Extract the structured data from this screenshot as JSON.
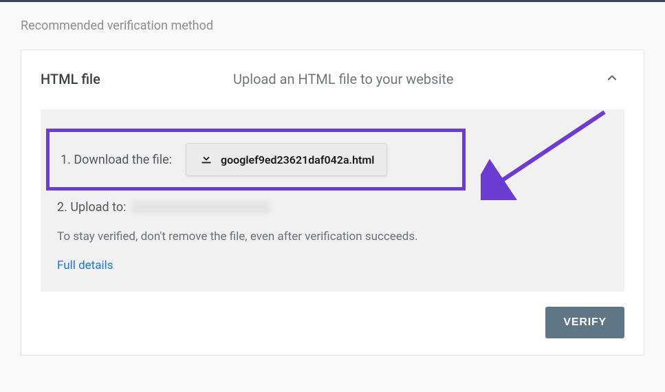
{
  "section_label": "Recommended verification method",
  "card": {
    "title": "HTML file",
    "subtitle": "Upload an HTML file to your website"
  },
  "steps": {
    "download_label": "1. Download the file:",
    "download_filename": "googlef9ed23621daf042a.html",
    "upload_label": "2. Upload to:"
  },
  "hint": "To stay verified, don't remove the file, even after verification succeeds.",
  "full_details": "Full details",
  "verify_button": "VERIFY"
}
